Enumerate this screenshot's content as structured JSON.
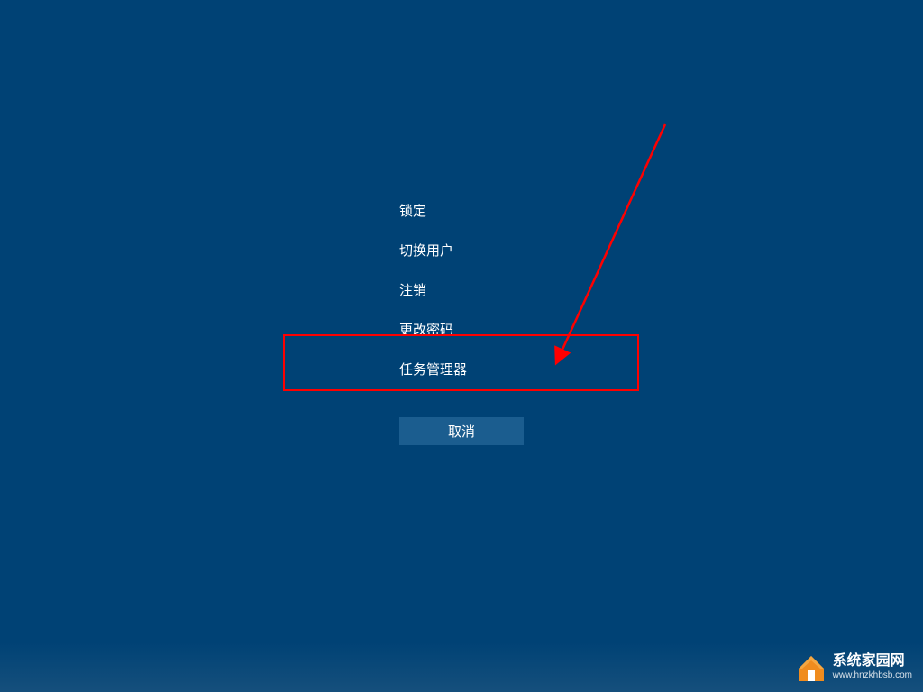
{
  "menu": {
    "items": [
      {
        "label": "锁定"
      },
      {
        "label": "切换用户"
      },
      {
        "label": "注销"
      },
      {
        "label": "更改密码"
      },
      {
        "label": "任务管理器"
      }
    ],
    "cancel_label": "取消"
  },
  "annotation": {
    "highlighted_item_index": 4,
    "arrow_color": "#ff0000",
    "highlight_color": "#ff0000"
  },
  "watermark": {
    "title": "系统家园网",
    "url": "www.hnzkhbsb.com"
  },
  "colors": {
    "background": "#004275",
    "button_bg": "#1b5d8f",
    "text": "#ffffff"
  }
}
